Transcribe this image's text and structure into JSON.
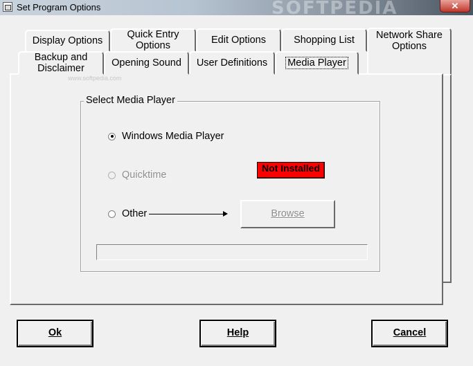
{
  "window": {
    "title": "Set Program Options",
    "watermark": "SOFTPEDIA",
    "close_glyph": "✕"
  },
  "tabs": {
    "back_row": [
      {
        "label": "Display Options"
      },
      {
        "label": "Quick Entry Options"
      },
      {
        "label": "Edit Options"
      },
      {
        "label": "Shopping List"
      },
      {
        "label": "Network Share Options"
      }
    ],
    "front_row": [
      {
        "label": "Backup and Disclaimer"
      },
      {
        "label": "Opening Sound"
      },
      {
        "label": "User Definitions"
      },
      {
        "label": "Media Player"
      }
    ],
    "active": "Media Player"
  },
  "panel": {
    "watermark": "www.softpedia.com"
  },
  "media_player": {
    "group_title": "Select Media Player",
    "options": [
      {
        "label": "Windows Media Player",
        "checked": true,
        "enabled": true
      },
      {
        "label": "Quicktime",
        "checked": false,
        "enabled": false
      },
      {
        "label": "Other",
        "checked": false,
        "enabled": true
      }
    ],
    "status_badge": "Not Installed",
    "status_color": "#ff0000",
    "browse_label": "Browse",
    "path_value": ""
  },
  "buttons": {
    "ok": "Ok",
    "help": "Help",
    "cancel": "Cancel"
  }
}
